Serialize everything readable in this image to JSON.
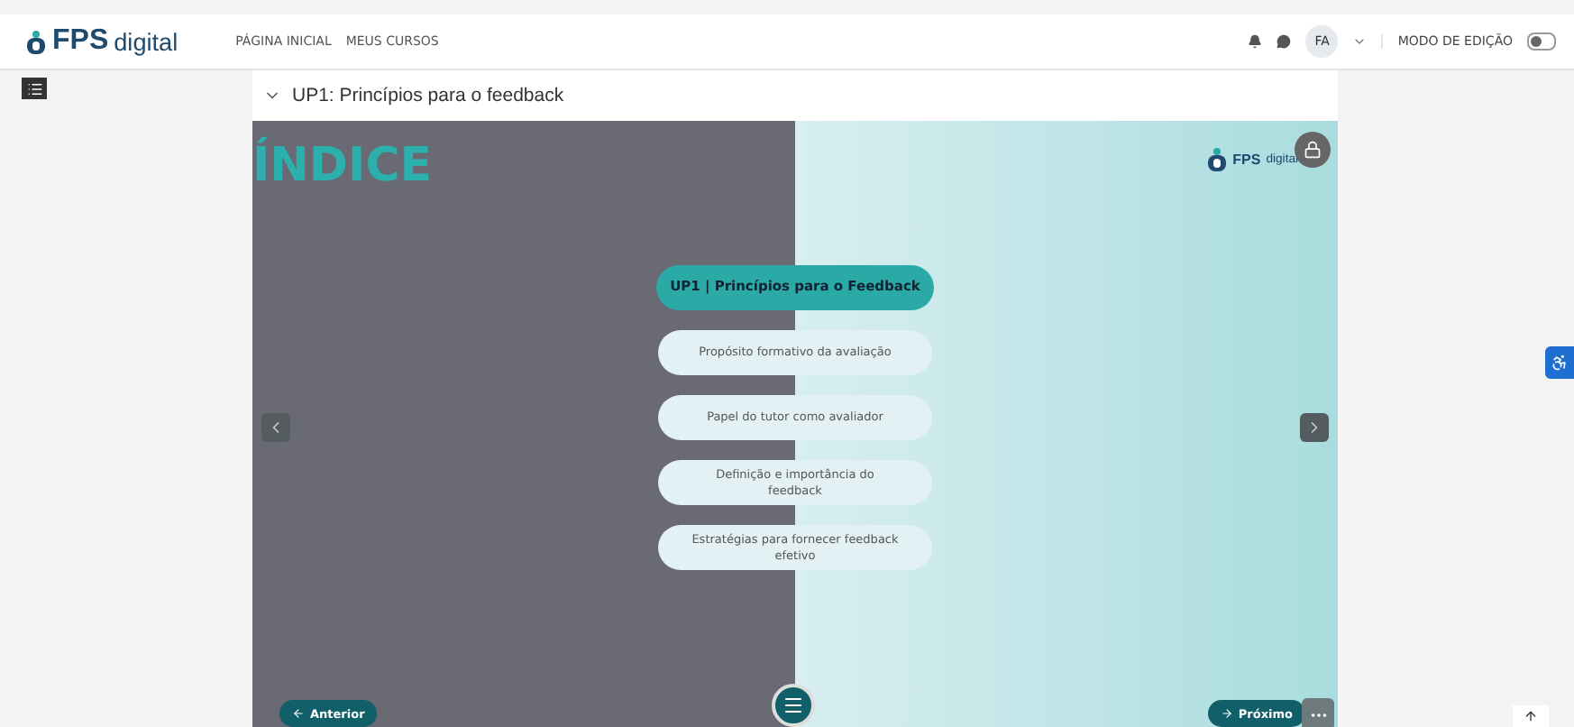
{
  "header": {
    "logo": {
      "bold": "FPS",
      "light": "digital"
    },
    "nav": [
      "PÁGINA INICIAL",
      "MEUS CURSOS"
    ],
    "user_initials": "FA",
    "edit_mode": {
      "label": "MODO DE EDIÇÃO",
      "on": false
    }
  },
  "section_title": "UP1: Princípios para o feedback",
  "slide": {
    "heading": "ÍNDICE",
    "logo": {
      "bold": "FPS",
      "light": "digital"
    },
    "items": [
      {
        "kind": "title",
        "text": "UP1 | Princípios para o Feedback"
      },
      {
        "kind": "topic",
        "text": "Propósito formativo da avaliação"
      },
      {
        "kind": "topic",
        "text": "Papel do tutor como avaliador"
      },
      {
        "kind": "topic",
        "text": "Definição e importância do feedback"
      },
      {
        "kind": "topic",
        "text": "Estratégias para fornecer feedback efetivo"
      }
    ],
    "prev": "Anterior",
    "next": "Próximo"
  }
}
